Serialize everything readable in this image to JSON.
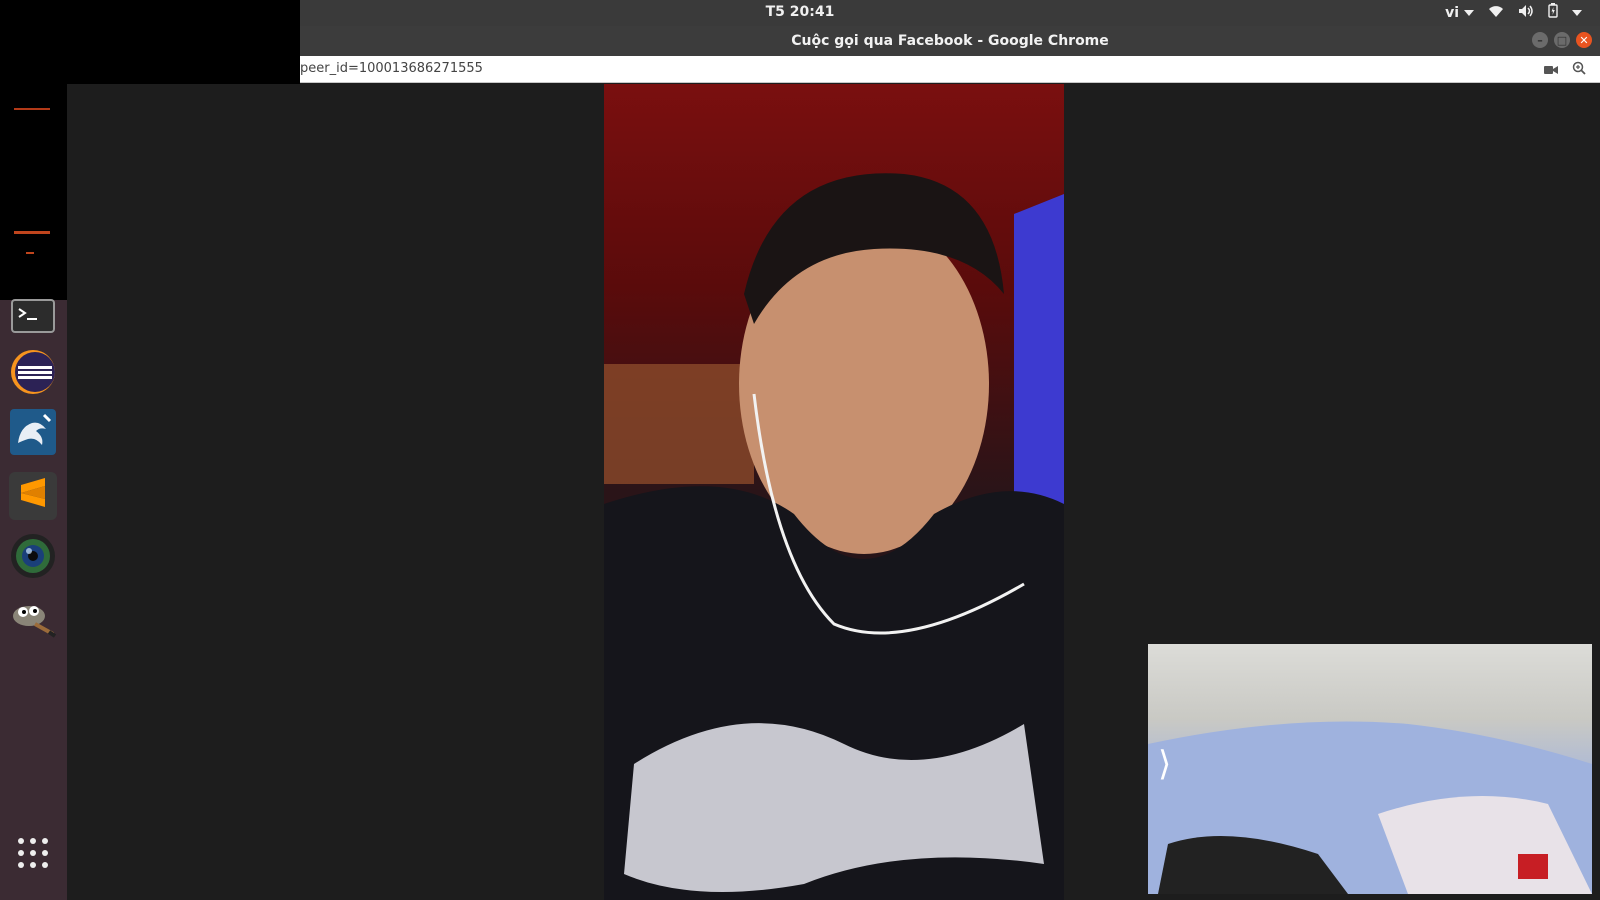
{
  "system_bar": {
    "clock": "T5 20:41",
    "language": "vi",
    "icons": [
      "wifi-icon",
      "volume-icon",
      "battery-icon",
      "power-menu-icon"
    ]
  },
  "window": {
    "title": "Cuộc gọi qua Facebook - Google Chrome",
    "controls": [
      "minimize",
      "maximize",
      "close"
    ]
  },
  "address_bar": {
    "url": "peer_id=100013686271555",
    "icons": [
      "camera-icon",
      "zoom-icon"
    ]
  },
  "dock": {
    "items": [
      "terminal",
      "eclipse",
      "mysql-workbench",
      "sublime-text",
      "webcam-app",
      "gimp",
      "show-applications"
    ]
  },
  "call": {
    "self_view_toggle": "⟩"
  }
}
